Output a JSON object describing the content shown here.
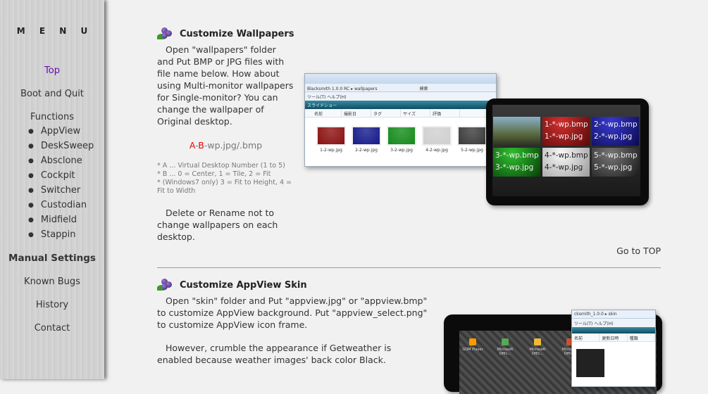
{
  "sidebar": {
    "title": "M E N U",
    "top": "Top",
    "boot": "Boot and Quit",
    "functions": "Functions",
    "function_items": [
      "AppView",
      "DeskSweep",
      "Absclone",
      "Cockpit",
      "Switcher",
      "Custodian",
      "Midfield",
      "Stappin"
    ],
    "manual": "Manual Settings",
    "bugs": "Known Bugs",
    "history": "History",
    "contact": "Contact"
  },
  "section1": {
    "title": "Customize Wallpapers",
    "body": "Open \"wallpapers\" folder and Put BMP or JPG files with file name below. How about using Multi-monitor wallpapers for Single-monitor? You can change the wallpaper of Original desktop.",
    "pattern_a": "A",
    "pattern_dash1": "-",
    "pattern_b": "B",
    "pattern_rest": "-wp.jpg/.bmp",
    "notes": [
      "* A ... Virtual Desktop Number (1 to 5)",
      "* B ... 0 = Center, 1 = Tile, 2 = Fit",
      "*      (Windows7 only)  3 = Fit to Height, 4 = Fit to Width"
    ],
    "body2": "Delete or Rename not to change wallpapers on each desktop.",
    "goto": "Go to TOP",
    "explorer": {
      "address": "Blacksmith 1.0.0 RC  ▸  wallpapers",
      "search": "検索",
      "menu": "ツール(T)   ヘルプ(H)",
      "slideshow": "スライドショー",
      "columns": [
        "名前",
        "撮影日",
        "タグ",
        "サイズ",
        "評価"
      ],
      "files": [
        {
          "name": "1-2-wp.jpg",
          "color": "#8a1010"
        },
        {
          "name": "2-2-wp.jpg",
          "color": "#141a8a"
        },
        {
          "name": "3-2-wp.jpg",
          "color": "#148a1a"
        },
        {
          "name": "4-2-wp.jpg",
          "color": "#cfcfcf"
        },
        {
          "name": "5-2-wp.jpg",
          "color": "#3a3a3a"
        }
      ]
    },
    "tiles": [
      {
        "l1": "",
        "l2": "",
        "bg": "linear-gradient(#8ab0c8,#5a6a40 60%,#2a3020)"
      },
      {
        "l1": "1-*-wp.bmp",
        "l2": "1-*-wp.jpg",
        "bg": "radial-gradient(circle at 40% 20%,#d03030,#5a0808)"
      },
      {
        "l1": "2-*-wp.bmp",
        "l2": "2-*-wp.jpg",
        "bg": "radial-gradient(circle at 40% 20%,#3a3ad0,#0a0a50)"
      },
      {
        "l1": "3-*-wp.bmp",
        "l2": "3-*-wp.jpg",
        "bg": "radial-gradient(circle at 40% 20%,#30c030,#064006)"
      },
      {
        "l1": "4-*-wp.bmp",
        "l2": "4-*-wp.jpg",
        "bg": "radial-gradient(circle at 40% 20%,#fafafa,#9a9a9a)"
      },
      {
        "l1": "5-*-wp.bmp",
        "l2": "5-*-wp.jpg",
        "bg": "radial-gradient(circle at 40% 20%,#777,#1a1a1a)"
      }
    ]
  },
  "section2": {
    "title": "Customize AppView Skin",
    "body": "Open \"skin\" folder and Put \"appview.jpg\" or \"appview.bmp\" to customize AppView background. Put \"appview_select.png\" to customize AppView icon frame.",
    "body2": "However, crumble the appearance if Getweather is enabled because weather images' back color Black.",
    "desktop_icons": [
      "GOM Player",
      "Microsoft Offic...",
      "Microsoft Offic...",
      "Microsoft Offic..."
    ],
    "explorer": {
      "address": "cksmith_1.0.0  ▸  skin",
      "menu": "ツール(T)   ヘルプ(H)",
      "columns": [
        "名前",
        "更新日時",
        "種類"
      ]
    }
  }
}
